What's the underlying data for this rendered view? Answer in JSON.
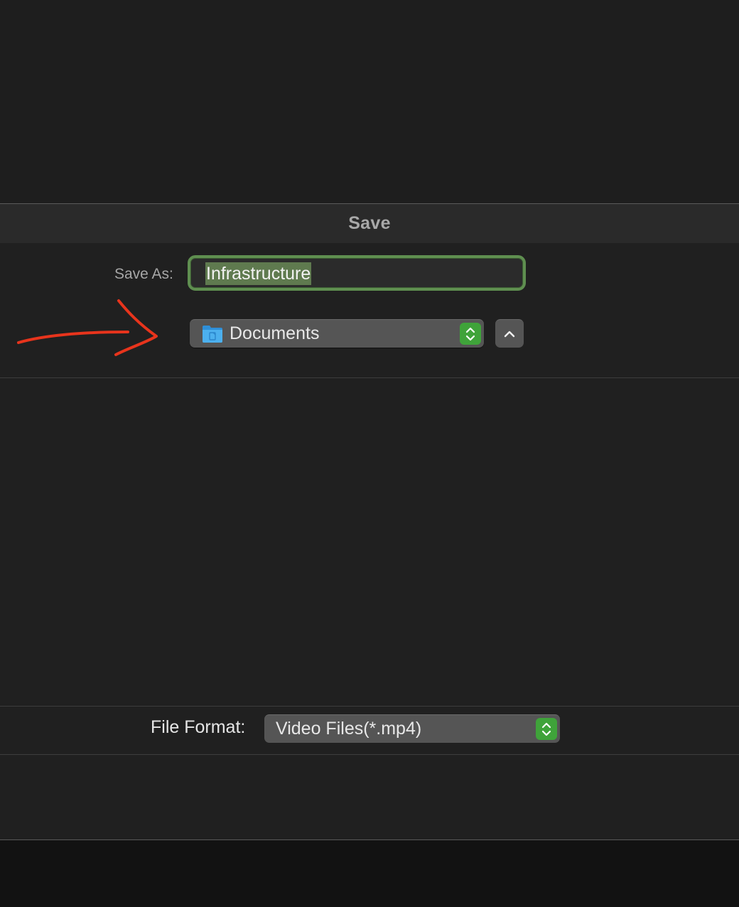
{
  "dialog": {
    "title": "Save"
  },
  "save_as": {
    "label": "Save As:",
    "value": "Infrastructure"
  },
  "location": {
    "selected": "Documents",
    "folder_icon": "folder-icon",
    "stepper_icon": "up-down-chevrons-icon",
    "expand_icon": "chevron-up-icon"
  },
  "file_format": {
    "label": "File Format:",
    "selected": "Video Files(*.mp4)",
    "stepper_icon": "up-down-chevrons-icon"
  },
  "annotation": {
    "type": "red-hand-drawn-arrow",
    "color": "#e8341c"
  },
  "colors": {
    "focus_ring": "#5f8f50",
    "selection": "#5f7a4f",
    "popup_accent": "#3fa33a"
  }
}
